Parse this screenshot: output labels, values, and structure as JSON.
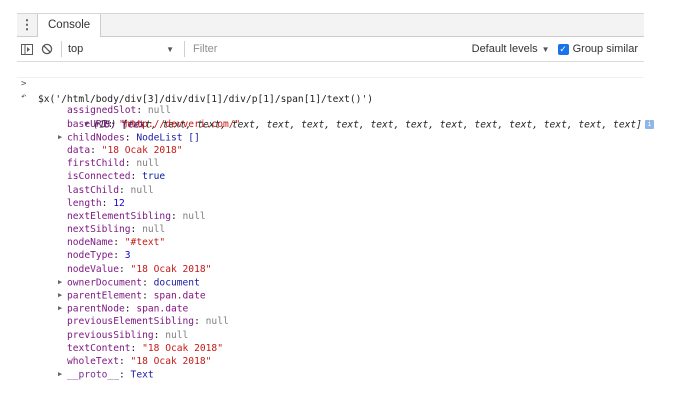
{
  "tabbar": {
    "menu_glyph": "⋮",
    "tab_label": "Console"
  },
  "toolbar": {
    "context": "top",
    "filter_placeholder": "Filter",
    "levels_label": "Default levels",
    "group_similar_label": "Group similar",
    "group_similar_checked": true
  },
  "console": {
    "command": "$x('/html/body/div[3]/div/div[1]/div/p[1]/span[1]/text()')",
    "result_summary": "(15) [text, text, text, text, text, text, text, text, text, text, text, text, text, text, text]",
    "item_label": "0: text",
    "props": [
      {
        "key": "assignedSlot",
        "value": "null",
        "kind": "nul",
        "expand": false
      },
      {
        "key": "baseURI",
        "value": "\"http://devveri.com/\"",
        "kind": "s",
        "expand": false
      },
      {
        "key": "childNodes",
        "value": "NodeList []",
        "kind": "obj",
        "expand": true
      },
      {
        "key": "data",
        "value": "\"18 Ocak 2018\"",
        "kind": "s",
        "expand": false
      },
      {
        "key": "firstChild",
        "value": "null",
        "kind": "nul",
        "expand": false
      },
      {
        "key": "isConnected",
        "value": "true",
        "kind": "b",
        "expand": false
      },
      {
        "key": "lastChild",
        "value": "null",
        "kind": "nul",
        "expand": false
      },
      {
        "key": "length",
        "value": "12",
        "kind": "n",
        "expand": false
      },
      {
        "key": "nextElementSibling",
        "value": "null",
        "kind": "nul",
        "expand": false
      },
      {
        "key": "nextSibling",
        "value": "null",
        "kind": "nul",
        "expand": false
      },
      {
        "key": "nodeName",
        "value": "\"#text\"",
        "kind": "s",
        "expand": false
      },
      {
        "key": "nodeType",
        "value": "3",
        "kind": "n",
        "expand": false
      },
      {
        "key": "nodeValue",
        "value": "\"18 Ocak 2018\"",
        "kind": "s",
        "expand": false
      },
      {
        "key": "ownerDocument",
        "value": "document",
        "kind": "obj",
        "expand": true
      },
      {
        "key": "parentElement",
        "value": "span.date",
        "kind": "el",
        "expand": true
      },
      {
        "key": "parentNode",
        "value": "span.date",
        "kind": "el",
        "expand": true
      },
      {
        "key": "previousElementSibling",
        "value": "null",
        "kind": "nul",
        "expand": false
      },
      {
        "key": "previousSibling",
        "value": "null",
        "kind": "nul",
        "expand": false
      },
      {
        "key": "textContent",
        "value": "\"18 Ocak 2018\"",
        "kind": "s",
        "expand": false
      },
      {
        "key": "wholeText",
        "value": "\"18 Ocak 2018\"",
        "kind": "s",
        "expand": false
      },
      {
        "key": "__proto__",
        "value": "Text",
        "kind": "obj",
        "expand": true,
        "dim": true
      }
    ]
  },
  "icons": {
    "sidebar": "sidebar-toggle-icon",
    "clear": "clear-console-icon",
    "prompt": "prompt-chevron-icon",
    "result": "result-arrow-icon",
    "info": "info-icon"
  },
  "colors": {
    "string": "#c41a16",
    "number": "#1c00cf",
    "key": "#7f1a85",
    "checkbox": "#1a73e8"
  }
}
